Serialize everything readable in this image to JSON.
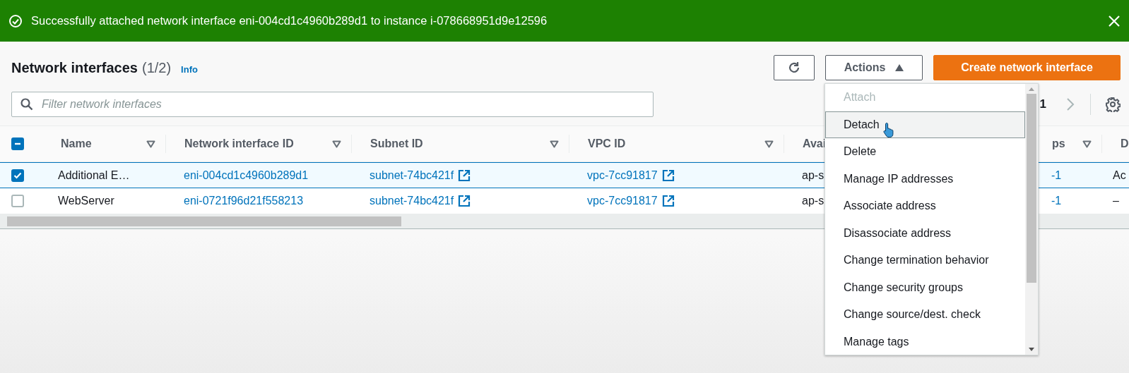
{
  "notification": {
    "kind": "success",
    "message": "Successfully attached network interface eni-004cd1c4960b289d1 to instance i-078668951d9e12596"
  },
  "header": {
    "title": "Network interfaces",
    "count": "(1/2)",
    "info": "Info"
  },
  "toolbar": {
    "actions": "Actions",
    "create": "Create network interface",
    "page": "1"
  },
  "search": {
    "placeholder": "Filter network interfaces"
  },
  "table": {
    "select_all": {
      "indeterminate": true
    },
    "columns": [
      {
        "label": "Name",
        "filterable": true,
        "kind": "text"
      },
      {
        "label": "Network interface ID",
        "filterable": true,
        "kind": "link"
      },
      {
        "label": "Subnet ID",
        "filterable": true,
        "kind": "external"
      },
      {
        "label": "VPC ID",
        "filterable": true,
        "kind": "external"
      },
      {
        "label": "Avai",
        "kind": "text"
      },
      {
        "label": "ps",
        "filterable": true,
        "kind": "link"
      },
      {
        "label": "D",
        "kind": "text"
      }
    ],
    "rows": [
      {
        "selected": true,
        "cells": [
          "Additional E…",
          "eni-004cd1c4960b289d1",
          "subnet-74bc421f",
          "vpc-7cc91817",
          "ap-s",
          "-1",
          "Ac"
        ]
      },
      {
        "selected": false,
        "cells": [
          "WebServer",
          "eni-0721f96d21f558213",
          "subnet-74bc421f",
          "vpc-7cc91817",
          "ap-s",
          "-1",
          "–"
        ]
      }
    ]
  },
  "menu": {
    "items": [
      {
        "label": "Attach",
        "disabled": true,
        "highlighted": false
      },
      {
        "label": "Detach",
        "disabled": false,
        "highlighted": true
      },
      {
        "label": "Delete",
        "disabled": false,
        "highlighted": false
      },
      {
        "label": "Manage IP addresses",
        "disabled": false,
        "highlighted": false
      },
      {
        "label": "Associate address",
        "disabled": false,
        "highlighted": false
      },
      {
        "label": "Disassociate address",
        "disabled": false,
        "highlighted": false
      },
      {
        "label": "Change termination behavior",
        "disabled": false,
        "highlighted": false
      },
      {
        "label": "Change security groups",
        "disabled": false,
        "highlighted": false
      },
      {
        "label": "Change source/dest. check",
        "disabled": false,
        "highlighted": false
      },
      {
        "label": "Manage tags",
        "disabled": false,
        "highlighted": false
      }
    ]
  }
}
